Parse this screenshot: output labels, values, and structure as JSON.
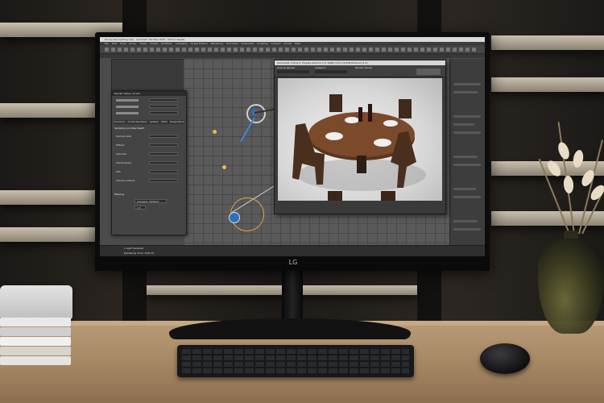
{
  "app": {
    "window_title": "Dining Set Lighting.max - Autodesk 3ds Max 2024 - Not for Resale",
    "menus": [
      "File",
      "Edit",
      "Tools",
      "Group",
      "Views",
      "Create",
      "Modifiers",
      "Animation",
      "Graph Editors",
      "Rendering",
      "Civil View",
      "Customize",
      "Scripting",
      "Content",
      "Arnold",
      "Help"
    ],
    "workspace": "Workspaces: Default"
  },
  "render_setup": {
    "title": "Render Setup: Arnold",
    "tabs": [
      "Common",
      "Arnold Renderer",
      "System",
      "AOVs",
      "Diagnostics",
      "Archive"
    ],
    "section": "Sampling and Ray Depth",
    "rows": [
      "Camera (AA)",
      "Diffuse",
      "Specular",
      "Transmission",
      "SSS",
      "Volume Indirect"
    ],
    "filtering": "Filtering",
    "filter_type": "Gaussian (default)",
    "filter_width": "1.5"
  },
  "frame_window": {
    "title": "Camera01, frame 0, Display Gamma 2.2, RGBA Color 16 Bits/Channel (1:1)",
    "area_label": "Area to Render",
    "viewport_label": "Viewport",
    "preset_label": "Render Preset"
  },
  "status": {
    "selection": "1 Light Selected",
    "prompt": "Rendering Time: 0:00:19"
  },
  "monitor": {
    "brand": "LG"
  },
  "colors": {
    "viewport_bg": "#5a5a5a",
    "ui_dark": "#3a3a3a",
    "gizmo_blue": "#3f86d6",
    "desk_wood": "#a98a66"
  }
}
